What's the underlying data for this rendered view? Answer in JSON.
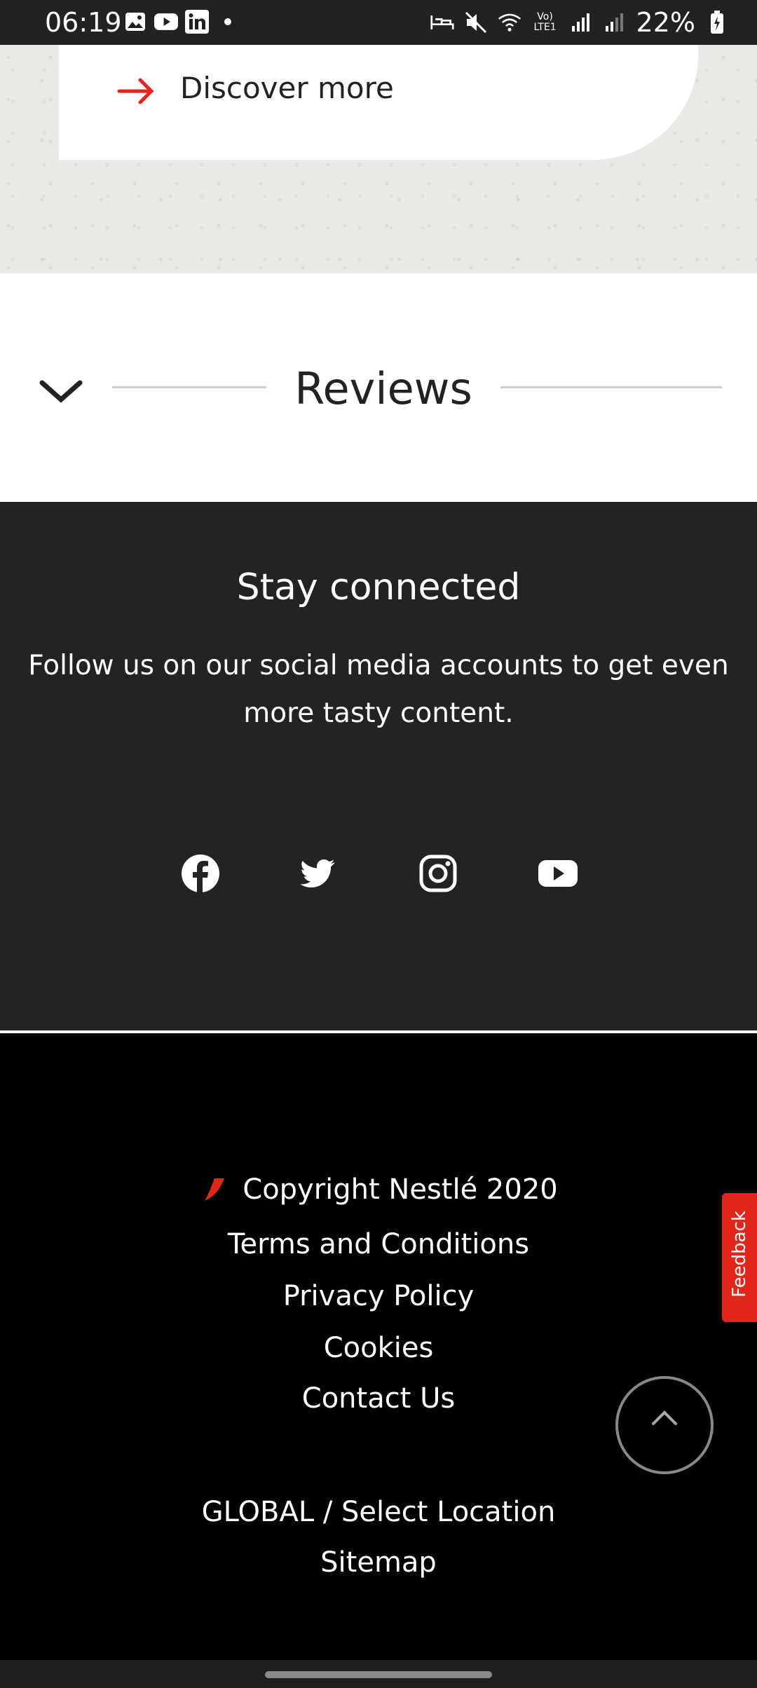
{
  "status_bar": {
    "time": "06:19",
    "battery": "22%",
    "notification_icons": [
      "image-icon",
      "youtube-icon",
      "linkedin-icon",
      "dot-icon"
    ],
    "system_icons": [
      "sleep-icon",
      "mute-icon",
      "wifi-icon",
      "volte-icon",
      "signal-icon",
      "signal-icon",
      "battery-charging-icon"
    ]
  },
  "discover": {
    "label": "Discover more",
    "accent": "#e1261c"
  },
  "reviews": {
    "title": "Reviews"
  },
  "stay_connected": {
    "title": "Stay connected",
    "body": "Follow us on our social media accounts to get even more tasty content.",
    "social": [
      "facebook-icon",
      "twitter-icon",
      "instagram-icon",
      "youtube-icon"
    ]
  },
  "footer": {
    "copyright": "Copyright Nestlé 2020",
    "links": [
      "Terms and Conditions",
      "Privacy Policy",
      "Cookies",
      "Contact Us"
    ],
    "location": "GLOBAL / Select Location",
    "sitemap": "Sitemap",
    "feedback": "Feedback"
  }
}
